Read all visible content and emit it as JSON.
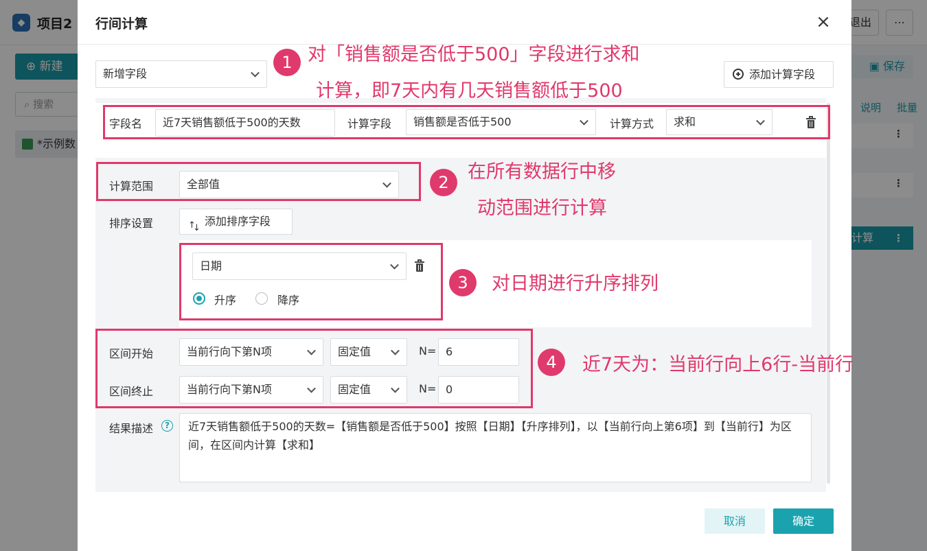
{
  "background": {
    "project": "项目2",
    "exit_label": "退出",
    "more_label": "⋯",
    "new_label": "新建",
    "search_placeholder": "搜索",
    "dataset_item": "*示例数",
    "save_label": "保存",
    "help_label": "说明",
    "batch_label": "批量",
    "calc_label": "计算"
  },
  "dialog": {
    "title": "行间计算",
    "close_label": "×",
    "field_mode": "新增字段",
    "add_calc_field": "添加计算字段",
    "row": {
      "name_label": "字段名",
      "name_value": "近7天销售额低于500的天数",
      "calc_field_label": "计算字段",
      "calc_field_value": "销售额是否低于500",
      "method_label": "计算方式",
      "method_value": "求和"
    },
    "range": {
      "label": "计算范围",
      "value": "全部值"
    },
    "sort": {
      "label": "排序设置",
      "add_button": "添加排序字段",
      "field": "日期",
      "asc": "升序",
      "desc": "降序",
      "selected": "asc"
    },
    "interval": {
      "start_label": "区间开始",
      "start_dir": "当前行向下第N项",
      "start_type": "固定值",
      "start_n_label": "N=",
      "start_n": "6",
      "end_label": "区间终止",
      "end_dir": "当前行向下第N项",
      "end_type": "固定值",
      "end_n_label": "N=",
      "end_n": "0"
    },
    "result": {
      "label": "结果描述",
      "help_icon": "?",
      "text": "近7天销售额低于500的天数=【销售额是否低于500】按照【日期】【升序排列】，以【当前行向上第6项】到【当前行】为区间，在区间内计算【求和】"
    },
    "cancel": "取消",
    "confirm": "确定"
  },
  "annotations": {
    "badge1": "1",
    "note1_line1": "对「销售额是否低于500」字段进行求和",
    "note1_line2": "计算，即7天内有几天销售额低于500",
    "badge2": "2",
    "note2_line1": "在所有数据行中移",
    "note2_line2": "动范围进行计算",
    "badge3": "3",
    "note3": "对日期进行升序排列",
    "badge4": "4",
    "note4": "近7天为：当前行向上6行-当前行"
  },
  "colors": {
    "accent": "#1aa3ae",
    "annotation": "#e0386a"
  }
}
